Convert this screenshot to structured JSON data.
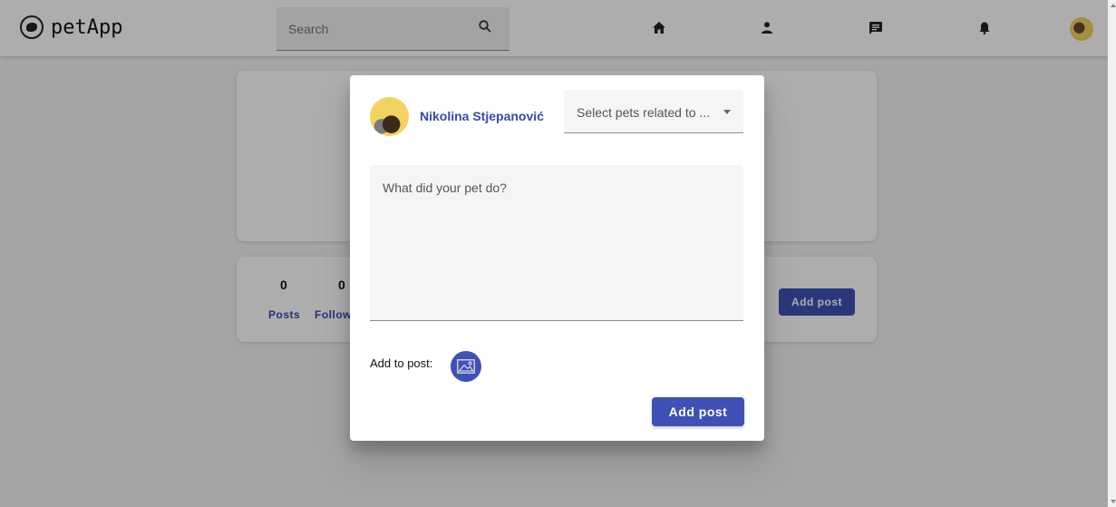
{
  "app": {
    "name": "petApp"
  },
  "search": {
    "placeholder": "Search"
  },
  "nav": {
    "icons": [
      "home-icon",
      "person-icon",
      "chat-icon",
      "bell-icon"
    ]
  },
  "profile": {
    "stats": [
      {
        "value": "0",
        "label": "Posts"
      },
      {
        "value": "0",
        "label": "Follow"
      }
    ],
    "add_post_label": "Add post"
  },
  "modal": {
    "user_name": "Nikolina Stjepanović",
    "pet_select_label": "Select pets related to ...",
    "post_placeholder": "What did your pet do?",
    "add_to_post_label": "Add to post:",
    "add_post_button": "Add post"
  },
  "colors": {
    "primary": "#3f51b5",
    "name_text": "#3949ab",
    "avatar_bg": "#f2d35f"
  }
}
